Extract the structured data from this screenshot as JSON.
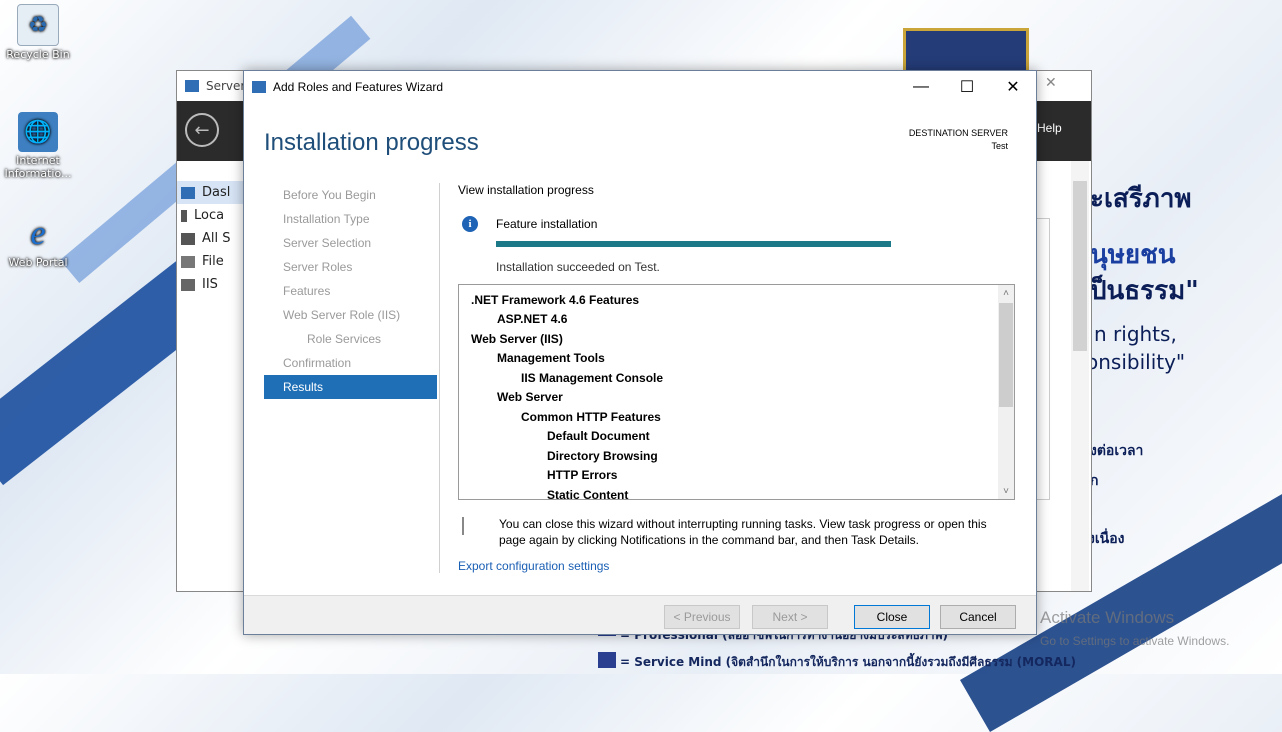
{
  "desktop": {
    "icons": [
      {
        "label": "Recycle Bin",
        "icon": "recycle-bin-icon"
      },
      {
        "label": "Internet Informatio...",
        "icon": "iis-manager-icon"
      },
      {
        "label": "Web Portal",
        "icon": "internet-explorer-icon"
      }
    ],
    "poster": {
      "line1": "ะเสรีภาพ",
      "line2": "นุษยชน",
      "line3": "ป็นธรรม\"",
      "line4": "n rights,",
      "line5": "onsibility\"",
      "line6": "งต่อเวลา",
      "line7": "ก",
      "line8": "งเนื่อง",
      "line9": "= Professional (ลออาชีพในการทำงานอย่างมีประสิทธิภาพ)",
      "line10": "= Service Mind (จิตสำนึกในการให้บริการ นอกจากนี้ยังรวมถึงมีศีลธรรม (MORAL)"
    },
    "watermark": {
      "title": "Activate Windows",
      "subtitle": "Go to Settings to activate Windows."
    }
  },
  "server_manager": {
    "title": "Server M",
    "help_label": "Help",
    "nav": [
      "Dashboard",
      "Local Server",
      "All Servers",
      "File and Storage Services",
      "IIS"
    ],
    "nav_visible": [
      "Dasl",
      "Loca",
      "All S",
      "File",
      "IIS"
    ]
  },
  "wizard": {
    "title": "Add Roles and Features Wizard",
    "heading": "Installation progress",
    "destination_label": "DESTINATION SERVER",
    "destination_value": "Test",
    "steps": [
      {
        "label": "Before You Begin",
        "sub": false,
        "active": false
      },
      {
        "label": "Installation Type",
        "sub": false,
        "active": false
      },
      {
        "label": "Server Selection",
        "sub": false,
        "active": false
      },
      {
        "label": "Server Roles",
        "sub": false,
        "active": false
      },
      {
        "label": "Features",
        "sub": false,
        "active": false
      },
      {
        "label": "Web Server Role (IIS)",
        "sub": false,
        "active": false
      },
      {
        "label": "Role Services",
        "sub": true,
        "active": false
      },
      {
        "label": "Confirmation",
        "sub": false,
        "active": false
      },
      {
        "label": "Results",
        "sub": false,
        "active": true
      }
    ],
    "view_progress_label": "View installation progress",
    "feature_installation_label": "Feature installation",
    "progress": 1.0,
    "status_text": "Installation succeeded on Test.",
    "features": [
      {
        "text": ".NET Framework 4.6 Features",
        "level": 0
      },
      {
        "text": "ASP.NET 4.6",
        "level": 1
      },
      {
        "text": "Web Server (IIS)",
        "level": 0
      },
      {
        "text": "Management Tools",
        "level": 1
      },
      {
        "text": "IIS Management Console",
        "level": 2
      },
      {
        "text": "Web Server",
        "level": 1
      },
      {
        "text": "Common HTTP Features",
        "level": 2
      },
      {
        "text": "Default Document",
        "level": 3
      },
      {
        "text": "Directory Browsing",
        "level": 3
      },
      {
        "text": "HTTP Errors",
        "level": 3
      },
      {
        "text": "Static Content",
        "level": 3
      }
    ],
    "note_line1": "You can close this wizard without interrupting running tasks. View task progress or open this",
    "note_line2": "page again by clicking Notifications in the command bar, and then Task Details.",
    "export_link": "Export configuration settings",
    "buttons": {
      "previous": "< Previous",
      "next": "Next >",
      "close": "Close",
      "cancel": "Cancel"
    },
    "window_controls": {
      "minimize": "—",
      "maximize": "☐",
      "close": "✕"
    }
  },
  "colors": {
    "accent": "#1f6fb6",
    "progress": "#1c7a88",
    "heading": "#1e4e79"
  }
}
